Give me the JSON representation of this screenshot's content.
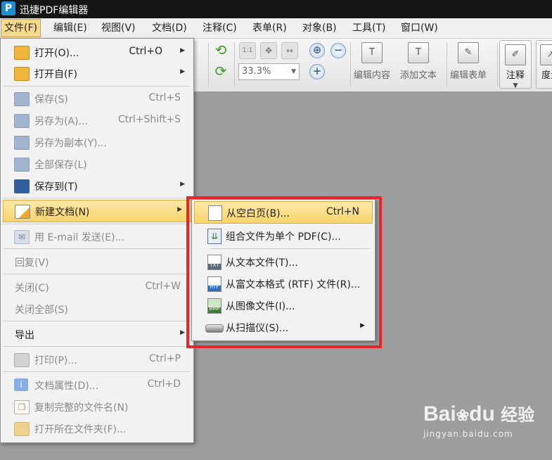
{
  "app": {
    "title": "迅捷PDF编辑器",
    "logo_letter": "P"
  },
  "menubar": [
    "文件(F)",
    "编辑(E)",
    "视图(V)",
    "文档(D)",
    "注释(C)",
    "表单(R)",
    "对象(B)",
    "工具(T)",
    "窗口(W)"
  ],
  "toolbar": {
    "zoom_value": "33.3%",
    "buttons": [
      "编辑内容",
      "添加文本",
      "编辑表单",
      "注释",
      "度量"
    ]
  },
  "file_menu": {
    "items": [
      {
        "label": "打开(O)...",
        "shortcut": "Ctrl+O",
        "icon": "folder-open-icon"
      },
      {
        "label": "打开自(F)",
        "shortcut": "",
        "icon": "folder-icon"
      },
      {
        "label": "保存(S)",
        "shortcut": "Ctrl+S",
        "icon": "save-icon"
      },
      {
        "label": "另存为(A)...",
        "shortcut": "Ctrl+Shift+S",
        "icon": "save-as-icon"
      },
      {
        "label": "另存为副本(Y)...",
        "shortcut": "",
        "icon": "save-copy-icon"
      },
      {
        "label": "全部保存(L)",
        "shortcut": "",
        "icon": "save-all-icon"
      },
      {
        "label": "保存到(T)",
        "shortcut": "",
        "icon": "save-to-icon"
      },
      {
        "label": "新建文档(N)",
        "shortcut": "",
        "icon": "new-document-icon"
      },
      {
        "label": "用 E-mail 发送(E)...",
        "shortcut": "",
        "icon": "email-icon"
      },
      {
        "label": "回复(V)",
        "shortcut": ""
      },
      {
        "label": "关闭(C)",
        "shortcut": "Ctrl+W"
      },
      {
        "label": "关闭全部(S)",
        "shortcut": ""
      },
      {
        "label": "导出",
        "shortcut": ""
      },
      {
        "label": "打印(P)...",
        "shortcut": "Ctrl+P",
        "icon": "printer-icon"
      },
      {
        "label": "文档属性(D)...",
        "shortcut": "Ctrl+D",
        "icon": "info-icon"
      },
      {
        "label": "复制完整的文件名(N)",
        "shortcut": "",
        "icon": "copy-filename-icon"
      },
      {
        "label": "打开所在文件夹(F)...",
        "shortcut": "",
        "icon": "open-folder-icon"
      }
    ]
  },
  "new_document_submenu": {
    "items": [
      {
        "label": "从空白页(B)...",
        "shortcut": "Ctrl+N",
        "icon_text": ""
      },
      {
        "label": "组合文件为单个 PDF(C)...",
        "shortcut": "",
        "icon_text": ""
      },
      {
        "label": "从文本文件(T)...",
        "shortcut": "",
        "icon_text": "TXT"
      },
      {
        "label": "从富文本格式 (RTF) 文件(R)...",
        "shortcut": "",
        "icon_text": "RTF"
      },
      {
        "label": "从图像文件(I)...",
        "shortcut": "",
        "icon_text": "BMP"
      },
      {
        "label": "从扫描仪(S)...",
        "shortcut": "",
        "icon_text": ""
      }
    ]
  },
  "watermark": {
    "main": "Bai",
    "main2": "du",
    "brand": "经验",
    "url": "jingyan.baidu.com"
  },
  "colors": {
    "highlight": "#f8d36c",
    "redbox": "#e8262a",
    "titlebar": "#151515"
  }
}
